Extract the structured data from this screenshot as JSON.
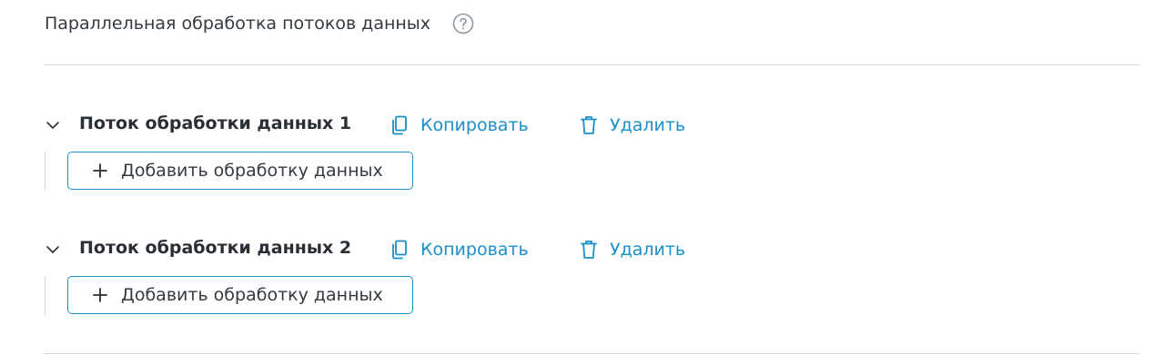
{
  "section": {
    "title": "Параллельная обработка потоков данных",
    "help_icon": "question-circle-icon"
  },
  "flows": [
    {
      "title": "Поток обработки данных 1",
      "copy_label": "Копировать",
      "delete_label": "Удалить",
      "add_label": "Добавить обработку данных"
    },
    {
      "title": "Поток обработки данных 2",
      "copy_label": "Копировать",
      "delete_label": "Удалить",
      "add_label": "Добавить обработку данных"
    }
  ],
  "colors": {
    "accent": "#1a8fc9",
    "text": "#333a40",
    "divider": "#d5d8dc"
  }
}
